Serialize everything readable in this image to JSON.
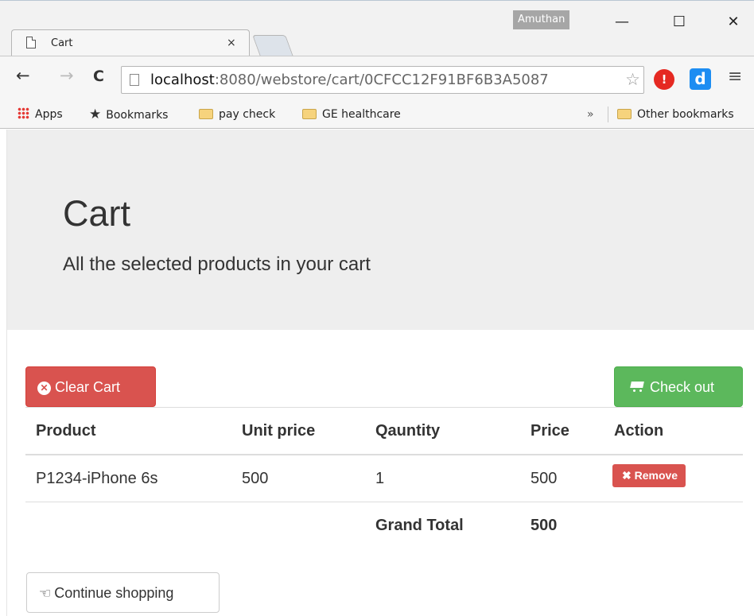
{
  "browser": {
    "profile_name": "Amuthan",
    "window_buttons": {
      "minimize": "—",
      "maximize": "☐",
      "close": "✕"
    },
    "tab": {
      "title": "Cart",
      "close": "×"
    },
    "url": {
      "host": "localhost",
      "path": ":8080/webstore/cart/0CFCC12F91BF6B3A5087"
    },
    "nav": {
      "back": "←",
      "forward": "→",
      "reload": "C"
    },
    "extensions": {
      "stop": "!",
      "d": "d"
    },
    "menu": "≡",
    "bookmarks": [
      {
        "label": "Apps",
        "icon": "apps-grid-icon"
      },
      {
        "label": "Bookmarks",
        "icon": "star-icon"
      },
      {
        "label": "pay check",
        "icon": "folder-icon"
      },
      {
        "label": "GE healthcare",
        "icon": "folder-icon"
      }
    ],
    "overflow": "»",
    "other_bookmarks": "Other bookmarks"
  },
  "jumbotron": {
    "title": "Cart",
    "subtitle": "All the selected products in your cart"
  },
  "actions": {
    "clear_cart": "Clear Cart",
    "check_out": "Check out",
    "continue_shopping": "Continue shopping"
  },
  "table": {
    "headers": [
      "Product",
      "Unit price",
      "Qauntity",
      "Price",
      "Action"
    ],
    "rows": [
      {
        "product": "P1234-iPhone 6s",
        "unit_price": "500",
        "quantity": "1",
        "price": "500",
        "action": "Remove"
      }
    ],
    "grand_total_label": "Grand Total",
    "grand_total_value": "500"
  },
  "colors": {
    "danger": "#d9534f",
    "success": "#5cb85c",
    "jumbotron_bg": "#eeeeee"
  }
}
